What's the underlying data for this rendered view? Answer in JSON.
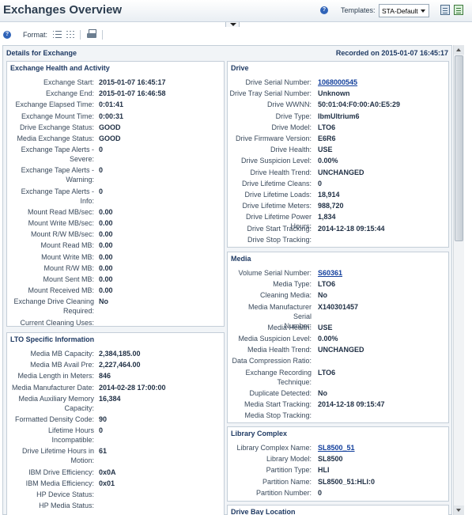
{
  "header": {
    "title": "Exchanges Overview",
    "templates_label": "Templates:",
    "template_value": "STA-Default"
  },
  "toolbar": {
    "format_label": "Format:"
  },
  "main": {
    "title": "Details for Exchange",
    "recorded": "Recorded on 2015-01-07 16:45:17"
  },
  "exchange_health": {
    "title": "Exchange Health and Activity",
    "rows": [
      {
        "label": [
          "Exchange Start:"
        ],
        "value": "2015-01-07 16:45:17"
      },
      {
        "label": [
          "Exchange End:"
        ],
        "value": "2015-01-07 16:46:58"
      },
      {
        "label": [
          "Exchange Elapsed Time:"
        ],
        "value": "0:01:41"
      },
      {
        "label": [
          "Exchange Mount Time:"
        ],
        "value": "0:00:31"
      },
      {
        "label": [
          "Drive Exchange Status:"
        ],
        "value": "GOOD"
      },
      {
        "label": [
          "Media Exchange Status:"
        ],
        "value": "GOOD"
      },
      {
        "label": [
          "Exchange Tape Alerts -",
          "Severe:"
        ],
        "value": "0"
      },
      {
        "label": [
          "Exchange Tape Alerts -",
          "Warning:"
        ],
        "value": "0"
      },
      {
        "label": [
          "Exchange Tape Alerts -",
          "Info:"
        ],
        "value": "0"
      },
      {
        "label": [
          "Mount Read MB/sec:"
        ],
        "value": "0.00"
      },
      {
        "label": [
          "Mount Write MB/sec:"
        ],
        "value": "0.00"
      },
      {
        "label": [
          "Mount R/W MB/sec:"
        ],
        "value": "0.00"
      },
      {
        "label": [
          "Mount Read MB:"
        ],
        "value": "0.00"
      },
      {
        "label": [
          "Mount Write MB:"
        ],
        "value": "0.00"
      },
      {
        "label": [
          "Mount R/W MB:"
        ],
        "value": "0.00"
      },
      {
        "label": [
          "Mount Sent MB:"
        ],
        "value": "0.00"
      },
      {
        "label": [
          "Mount Received MB:"
        ],
        "value": "0.00"
      },
      {
        "label": [
          "Exchange Drive Cleaning",
          "Required:"
        ],
        "value": "No"
      },
      {
        "label": [
          "Current Cleaning Uses:"
        ],
        "value": ""
      }
    ]
  },
  "lto": {
    "title": "LTO Specific Information",
    "rows": [
      {
        "label": [
          "Media MB Capacity:"
        ],
        "value": "2,384,185.00"
      },
      {
        "label": [
          "Media MB Avail Pre:"
        ],
        "value": "2,227,464.00"
      },
      {
        "label": [
          "Media Length in Meters:"
        ],
        "value": "846"
      },
      {
        "label": [
          "Media Manufacturer Date:"
        ],
        "value": "2014-02-28 17:00:00"
      },
      {
        "label": [
          "Media Auxiliary Memory",
          "Capacity:"
        ],
        "value": "16,384"
      },
      {
        "label": [
          "Formatted Density Code:"
        ],
        "value": "90"
      },
      {
        "label": [
          "Lifetime Hours",
          "Incompatible:"
        ],
        "value": "0"
      },
      {
        "label": [
          "Drive Lifetime Hours in",
          "Motion:"
        ],
        "value": "61"
      },
      {
        "label": [
          "IBM Drive Efficiency:"
        ],
        "value": "0x0A"
      },
      {
        "label": [
          "IBM Media Efficiency:"
        ],
        "value": "0x01"
      },
      {
        "label": [
          "HP Device Status:"
        ],
        "value": ""
      },
      {
        "label": [
          "HP Media Status:"
        ],
        "value": ""
      }
    ]
  },
  "drive": {
    "title": "Drive",
    "rows": [
      {
        "label": [
          "Drive Serial Number:"
        ],
        "value": "1068000545",
        "link": true
      },
      {
        "label": [
          "Drive Tray Serial Number:"
        ],
        "value": "Unknown"
      },
      {
        "label": [
          "Drive WWNN:"
        ],
        "value": "50:01:04:F0:00:A0:E5:29"
      },
      {
        "label": [
          "Drive Type:"
        ],
        "value": "IbmUltrium6"
      },
      {
        "label": [
          "Drive Model:"
        ],
        "value": "LTO6"
      },
      {
        "label": [
          "Drive Firmware Version:"
        ],
        "value": "E6R6"
      },
      {
        "label": [
          "Drive Health:"
        ],
        "value": "USE"
      },
      {
        "label": [
          "Drive Suspicion Level:"
        ],
        "value": "0.00%"
      },
      {
        "label": [
          "Drive Health Trend:"
        ],
        "value": "UNCHANGED"
      },
      {
        "label": [
          "Drive Lifetime Cleans:"
        ],
        "value": "0"
      },
      {
        "label": [
          "Drive Lifetime Loads:"
        ],
        "value": "18,914"
      },
      {
        "label": [
          "Drive Lifetime Meters:"
        ],
        "value": "988,720"
      },
      {
        "label": [
          "Drive Lifetime Power Hours:"
        ],
        "value": "1,834"
      },
      {
        "label": [
          "Drive Start Tracking:"
        ],
        "value": "2014-12-18 09:15:44"
      },
      {
        "label": [
          "Drive Stop Tracking:"
        ],
        "value": ""
      }
    ]
  },
  "media": {
    "title": "Media",
    "rows": [
      {
        "label": [
          "Volume Serial Number:"
        ],
        "value": "S60361",
        "link": true
      },
      {
        "label": [
          "Media Type:"
        ],
        "value": "LTO6"
      },
      {
        "label": [
          "Cleaning Media:"
        ],
        "value": "No"
      },
      {
        "label": [
          "Media Manufacturer Serial",
          "Number:"
        ],
        "value": "X140301457"
      },
      {
        "label": [
          "Media Health:"
        ],
        "value": "USE"
      },
      {
        "label": [
          "Media Suspicion Level:"
        ],
        "value": "0.00%"
      },
      {
        "label": [
          "Media Health Trend:"
        ],
        "value": "UNCHANGED"
      },
      {
        "label": [
          "Data Compression Ratio:"
        ],
        "value": ""
      },
      {
        "label": [
          "Exchange Recording",
          "Technique:"
        ],
        "value": "LTO6"
      },
      {
        "label": [
          "Duplicate Detected:"
        ],
        "value": "No"
      },
      {
        "label": [
          "Media Start Tracking:"
        ],
        "value": "2014-12-18 09:15:47"
      },
      {
        "label": [
          "Media Stop Tracking:"
        ],
        "value": ""
      }
    ]
  },
  "library": {
    "title": "Library Complex",
    "rows": [
      {
        "label": [
          "Library Complex Name:"
        ],
        "value": "SL8500_51",
        "link": true
      },
      {
        "label": [
          "Library Model:"
        ],
        "value": "SL8500"
      },
      {
        "label": [
          "Partition Type:"
        ],
        "value": "HLI"
      },
      {
        "label": [
          "Partition Name:"
        ],
        "value": "SL8500_51:HLI:0"
      },
      {
        "label": [
          "Partition Number:"
        ],
        "value": "0"
      }
    ]
  },
  "drive_bay": {
    "title": "Drive Bay Location"
  }
}
